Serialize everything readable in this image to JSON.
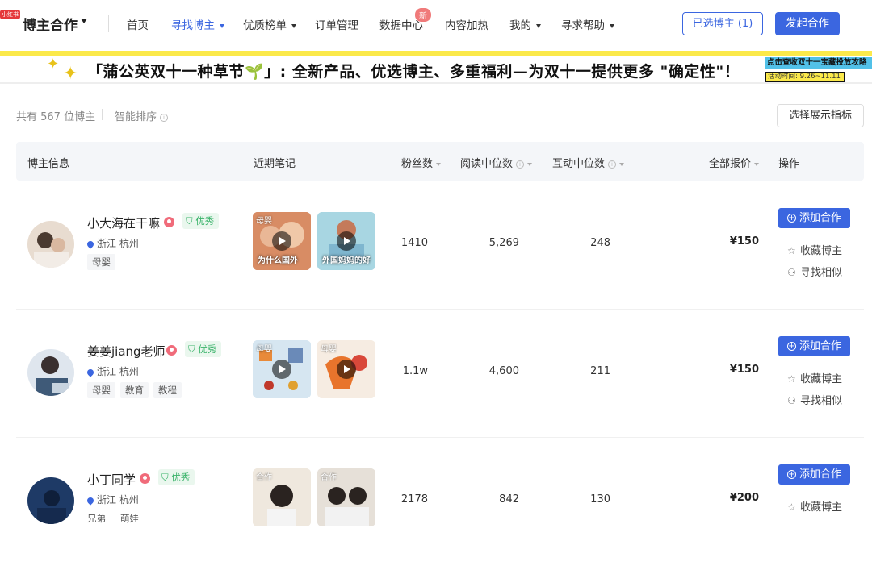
{
  "header": {
    "logo_badge": "小红书",
    "brand": "博主合作",
    "nav": [
      {
        "label": "首页"
      },
      {
        "label": "寻找博主"
      },
      {
        "label": "优质榜单"
      },
      {
        "label": "订单管理"
      },
      {
        "label": "数据中心",
        "badge": "新"
      },
      {
        "label": "内容加热"
      },
      {
        "label": "我的"
      },
      {
        "label": "寻求帮助"
      }
    ],
    "selected_button": "已选博主 (1)",
    "start_button": "发起合作",
    "accent": "#3b66e0"
  },
  "banner": {
    "text": "「蒲公英双十一种草节🌱」: 全新产品、优选博主、多重福利—为双十一提供更多 \"确定性\"！",
    "side_text": "点击查收双十一宝藏投放攻略",
    "date_text": "活动时间: 9.26~11.11"
  },
  "toolbar": {
    "count_text": "共有 567 位博主",
    "sort_text": "智能排序",
    "metric_button": "选择展示指标"
  },
  "table": {
    "columns": {
      "info": "博主信息",
      "notes": "近期笔记",
      "fans": "粉丝数",
      "read": "阅读中位数",
      "interact": "互动中位数",
      "price": "全部报价",
      "action": "操作"
    },
    "rows": [
      {
        "name": "小大海在干嘛",
        "badge": "优秀",
        "location": "浙江 杭州",
        "tags": [
          "母婴"
        ],
        "notes": [
          {
            "tag": "母婴",
            "caption": "为什么国外"
          },
          {
            "tag": "",
            "caption": "外国妈妈的好"
          }
        ],
        "fans": "1410",
        "read": "5,269",
        "interact": "248",
        "price": "¥150"
      },
      {
        "name": "姜姜jiang老师",
        "badge": "优秀",
        "location": "浙江 杭州",
        "tags": [
          "母婴",
          "教育",
          "教程"
        ],
        "notes": [
          {
            "tag": "母婴",
            "caption": ""
          },
          {
            "tag": "母婴",
            "caption": ""
          }
        ],
        "fans": "1.1w",
        "read": "4,600",
        "interact": "211",
        "price": "¥150"
      },
      {
        "name": "小丁同学",
        "badge": "优秀",
        "location": "浙江 杭州",
        "tags": [
          "兄弟",
          "萌娃"
        ],
        "notes": [
          {
            "tag": "合作",
            "caption": ""
          },
          {
            "tag": "合作",
            "caption": ""
          }
        ],
        "fans": "2178",
        "read": "842",
        "interact": "130",
        "price": "¥200"
      }
    ],
    "actions": {
      "add": "添加合作",
      "favorite": "收藏博主",
      "similar": "寻找相似"
    }
  }
}
